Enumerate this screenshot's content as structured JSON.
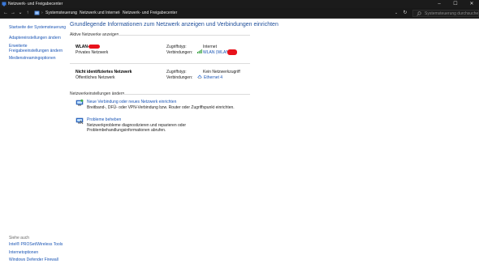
{
  "window": {
    "title": "Netzwerk- und Freigabecenter",
    "controls": {
      "minimize": "–",
      "maximize": "☐",
      "close": "✕"
    }
  },
  "nav": {
    "back": "←",
    "forward": "→",
    "recent": "⌄",
    "up": "↑",
    "refresh": "↻",
    "dropdown": "⌄"
  },
  "breadcrumb": {
    "items": [
      "Systemsteuerung",
      "Netzwerk und Internet",
      "Netzwerk- und Freigabecenter"
    ],
    "separator": "›"
  },
  "search": {
    "placeholder": "Systemsteuerung durchsuchen"
  },
  "sidebar": {
    "items": [
      {
        "label": "Startseite der Systemsteuerung"
      },
      {
        "label": "Adaptereinstellungen ändern"
      },
      {
        "label": "Erweiterte"
      },
      {
        "label": "Freigabeeinstellungen ändern"
      },
      {
        "label": "Medienstreamingoptionen"
      }
    ]
  },
  "see_also": {
    "title": "Siehe auch",
    "items": [
      {
        "label": "Intel® PROSet/Wireless Tools"
      },
      {
        "label": "Internetoptionen"
      },
      {
        "label": "Windows Defender Firewall"
      }
    ]
  },
  "main": {
    "title": "Grundlegende Informationen zum Netzwerk anzeigen und Verbindungen einrichten",
    "active_networks_label": "Aktive Netzwerke anzeigen",
    "networks": [
      {
        "name": "WLAN-",
        "type": "Privates Netzwerk",
        "access_label": "Zugriffstyp:",
        "access_value": "Internet",
        "conn_label": "Verbindungen:",
        "conn_value": "WLAN (WLAN-"
      },
      {
        "name": "Nicht identifiziertes Netzwerk",
        "type": "Öffentliches Netzwerk",
        "access_label": "Zugriffstyp:",
        "access_value": "Kein Netzwerkzugriff",
        "conn_label": "Verbindungen:",
        "conn_value": "Ethernet 4"
      }
    ],
    "change_settings_label": "Netzwerkeinstellungen ändern",
    "tasks": [
      {
        "link": "Neue Verbindung oder neues Netzwerk einrichten",
        "desc": "Breitband-, DFÜ- oder VPN-Verbindung bzw. Router oder Zugriffspunkt einrichten."
      },
      {
        "link": "Probleme beheben",
        "desc": "Netzwerkprobleme diagnostizieren und reparieren oder Problembehandlungsinformationen abrufen."
      }
    ]
  },
  "colors": {
    "link": "#1a55b5",
    "title": "#1e4e9a",
    "chrome": "#1b1b1b",
    "redaction": "#e8121c",
    "wifi_signal": "#2f9e3a"
  }
}
